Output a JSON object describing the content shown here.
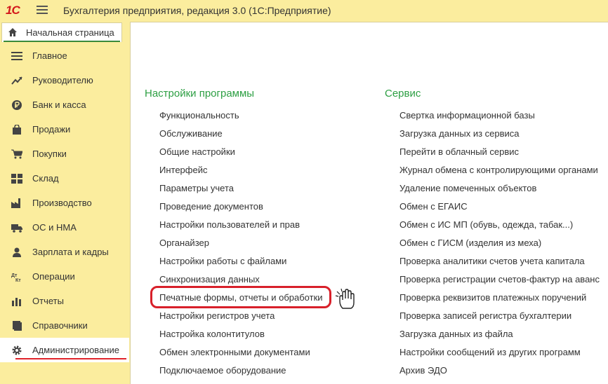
{
  "titlebar": {
    "logo_text": "1С",
    "title": "Бухгалтерия предприятия, редакция 3.0  (1С:Предприятие)"
  },
  "home_tab": {
    "label": "Начальная страница",
    "icon": "home-icon"
  },
  "sidebar": {
    "items": [
      {
        "label": "Главное",
        "icon": "list-icon"
      },
      {
        "label": "Руководителю",
        "icon": "trend-icon"
      },
      {
        "label": "Банк и касса",
        "icon": "ruble-icon"
      },
      {
        "label": "Продажи",
        "icon": "bag-icon"
      },
      {
        "label": "Покупки",
        "icon": "cart-icon"
      },
      {
        "label": "Склад",
        "icon": "grid-icon"
      },
      {
        "label": "Производство",
        "icon": "factory-icon"
      },
      {
        "label": "ОС и НМА",
        "icon": "truck-icon"
      },
      {
        "label": "Зарплата и кадры",
        "icon": "person-icon"
      },
      {
        "label": "Операции",
        "icon": "dt-kt-icon"
      },
      {
        "label": "Отчеты",
        "icon": "bar-chart-icon"
      },
      {
        "label": "Справочники",
        "icon": "book-icon"
      },
      {
        "label": "Администрирование",
        "icon": "gear-icon",
        "active": true
      }
    ]
  },
  "main": {
    "settings": {
      "title": "Настройки программы",
      "links": [
        "Функциональность",
        "Обслуживание",
        "Общие настройки",
        "Интерфейс",
        "Параметры учета",
        "Проведение документов",
        "Настройки пользователей и прав",
        "Органайзер",
        "Настройки работы с файлами",
        "Синхронизация данных",
        "Печатные формы, отчеты и обработки",
        "Настройки регистров учета",
        "Настройка колонтитулов",
        "Обмен электронными документами",
        "Подключаемое оборудование"
      ]
    },
    "service": {
      "title": "Сервис",
      "links": [
        "Свертка информационной базы",
        "Загрузка данных из сервиса",
        "Перейти в облачный сервис",
        "Журнал обмена с контролирующими органами",
        "Удаление помеченных объектов",
        "Обмен с ЕГАИС",
        "Обмен с ИС МП (обувь, одежда, табак...)",
        "Обмен с ГИСМ (изделия из меха)",
        "Проверка аналитики счетов учета капитала",
        "Проверка регистрации счетов-фактур на аванс",
        "Проверка реквизитов платежных поручений",
        "Проверка записей регистра бухгалтерии",
        "Загрузка данных из файла",
        "Настройки сообщений из других программ",
        "Архив ЭДО"
      ]
    }
  },
  "colors": {
    "accent_green": "#2d9f43",
    "highlight_red": "#d8202a",
    "panel_yellow": "#fbed9e"
  }
}
